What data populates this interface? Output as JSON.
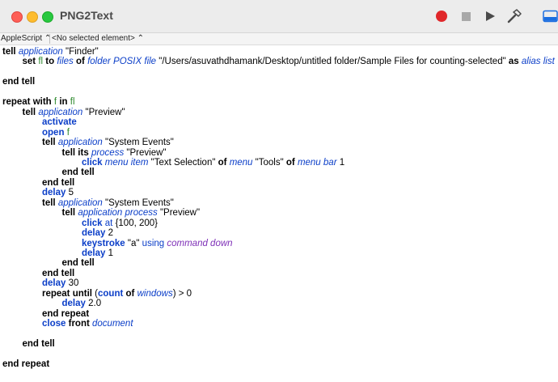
{
  "window": {
    "title": "PNG2Text"
  },
  "toolbar": {
    "record_icon": "record-icon",
    "stop_icon": "stop-icon",
    "run_icon": "run-icon",
    "compile_icon": "hammer-icon",
    "panel_icon": "sidebar-panel-icon"
  },
  "navbar": {
    "language": "AppleScript ⌃",
    "element": "<No selected element> ⌃"
  },
  "code": {
    "lines": [
      {
        "indent": 0,
        "tokens": [
          [
            "kw",
            "tell"
          ],
          [
            "t",
            " "
          ],
          [
            "cls",
            "application"
          ],
          [
            "t",
            " \"Finder\""
          ]
        ]
      },
      {
        "indent": 1,
        "tokens": [
          [
            "kw",
            "set"
          ],
          [
            "t",
            " "
          ],
          [
            "var",
            "fl"
          ],
          [
            "t",
            " "
          ],
          [
            "kw",
            "to"
          ],
          [
            "t",
            " "
          ],
          [
            "cls",
            "files"
          ],
          [
            "t",
            " "
          ],
          [
            "kw",
            "of"
          ],
          [
            "t",
            " "
          ],
          [
            "cls",
            "folder POSIX file"
          ],
          [
            "t",
            " \"/Users/asuvathdhamank/Desktop/untitled folder/Sample Files for counting-selected\" "
          ],
          [
            "kw",
            "as"
          ],
          [
            "t",
            " "
          ],
          [
            "cls",
            "alias list"
          ]
        ]
      },
      {
        "indent": 0,
        "tokens": []
      },
      {
        "indent": 0,
        "tokens": [
          [
            "kw",
            "end tell"
          ]
        ]
      },
      {
        "indent": 0,
        "tokens": []
      },
      {
        "indent": 0,
        "tokens": [
          [
            "kw",
            "repeat with"
          ],
          [
            "t",
            " "
          ],
          [
            "var",
            "f"
          ],
          [
            "t",
            " "
          ],
          [
            "kw",
            "in"
          ],
          [
            "t",
            " "
          ],
          [
            "var",
            "fl"
          ]
        ]
      },
      {
        "indent": 1,
        "tokens": [
          [
            "kw",
            "tell"
          ],
          [
            "t",
            " "
          ],
          [
            "cls",
            "application"
          ],
          [
            "t",
            " \"Preview\""
          ]
        ]
      },
      {
        "indent": 2,
        "tokens": [
          [
            "cmd",
            "activate"
          ]
        ]
      },
      {
        "indent": 2,
        "tokens": [
          [
            "cmd",
            "open"
          ],
          [
            "t",
            " "
          ],
          [
            "var",
            "f"
          ]
        ]
      },
      {
        "indent": 2,
        "tokens": [
          [
            "kw",
            "tell"
          ],
          [
            "t",
            " "
          ],
          [
            "cls",
            "application"
          ],
          [
            "t",
            " \"System Events\""
          ]
        ]
      },
      {
        "indent": 3,
        "tokens": [
          [
            "kw",
            "tell its"
          ],
          [
            "t",
            " "
          ],
          [
            "cls",
            "process"
          ],
          [
            "t",
            " \"Preview\""
          ]
        ]
      },
      {
        "indent": 4,
        "tokens": [
          [
            "cmd",
            "click"
          ],
          [
            "t",
            " "
          ],
          [
            "cls",
            "menu item"
          ],
          [
            "t",
            " \"Text Selection\" "
          ],
          [
            "kw",
            "of"
          ],
          [
            "t",
            " "
          ],
          [
            "cls",
            "menu"
          ],
          [
            "t",
            " \"Tools\" "
          ],
          [
            "kw",
            "of"
          ],
          [
            "t",
            " "
          ],
          [
            "cls",
            "menu bar"
          ],
          [
            "t",
            " 1"
          ]
        ]
      },
      {
        "indent": 3,
        "tokens": [
          [
            "kw",
            "end tell"
          ]
        ]
      },
      {
        "indent": 2,
        "tokens": [
          [
            "kw",
            "end tell"
          ]
        ]
      },
      {
        "indent": 2,
        "tokens": [
          [
            "cmd",
            "delay"
          ],
          [
            "t",
            " 5"
          ]
        ]
      },
      {
        "indent": 2,
        "tokens": [
          [
            "kw",
            "tell"
          ],
          [
            "t",
            " "
          ],
          [
            "cls",
            "application"
          ],
          [
            "t",
            " \"System Events\""
          ]
        ]
      },
      {
        "indent": 3,
        "tokens": [
          [
            "kw",
            "tell"
          ],
          [
            "t",
            " "
          ],
          [
            "cls",
            "application process"
          ],
          [
            "t",
            " \"Preview\""
          ]
        ]
      },
      {
        "indent": 4,
        "tokens": [
          [
            "cmd",
            "click"
          ],
          [
            "t",
            " "
          ],
          [
            "prop",
            "at"
          ],
          [
            "t",
            " {100, 200}"
          ]
        ]
      },
      {
        "indent": 4,
        "tokens": [
          [
            "cmd",
            "delay"
          ],
          [
            "t",
            " 2"
          ]
        ]
      },
      {
        "indent": 4,
        "tokens": [
          [
            "cmd",
            "keystroke"
          ],
          [
            "t",
            " \"a\" "
          ],
          [
            "prop",
            "using"
          ],
          [
            "t",
            " "
          ],
          [
            "enum",
            "command down"
          ]
        ]
      },
      {
        "indent": 4,
        "tokens": [
          [
            "cmd",
            "delay"
          ],
          [
            "t",
            " 1"
          ]
        ]
      },
      {
        "indent": 3,
        "tokens": [
          [
            "kw",
            "end tell"
          ]
        ]
      },
      {
        "indent": 2,
        "tokens": [
          [
            "kw",
            "end tell"
          ]
        ]
      },
      {
        "indent": 2,
        "tokens": [
          [
            "cmd",
            "delay"
          ],
          [
            "t",
            " 30"
          ]
        ]
      },
      {
        "indent": 2,
        "tokens": [
          [
            "kw",
            "repeat until"
          ],
          [
            "t",
            " ("
          ],
          [
            "cmd",
            "count"
          ],
          [
            "t",
            " "
          ],
          [
            "kw",
            "of"
          ],
          [
            "t",
            " "
          ],
          [
            "cls",
            "windows"
          ],
          [
            "t",
            ") > 0"
          ]
        ]
      },
      {
        "indent": 3,
        "tokens": [
          [
            "cmd",
            "delay"
          ],
          [
            "t",
            " 2.0"
          ]
        ]
      },
      {
        "indent": 2,
        "tokens": [
          [
            "kw",
            "end repeat"
          ]
        ]
      },
      {
        "indent": 2,
        "tokens": [
          [
            "cmd",
            "close"
          ],
          [
            "t",
            " "
          ],
          [
            "kw",
            "front"
          ],
          [
            "t",
            " "
          ],
          [
            "cls",
            "document"
          ]
        ]
      },
      {
        "indent": 1,
        "tokens": []
      },
      {
        "indent": 1,
        "tokens": [
          [
            "kw",
            "end tell"
          ]
        ]
      },
      {
        "indent": 0,
        "tokens": []
      },
      {
        "indent": 0,
        "tokens": [
          [
            "kw",
            "end repeat"
          ]
        ]
      }
    ]
  }
}
